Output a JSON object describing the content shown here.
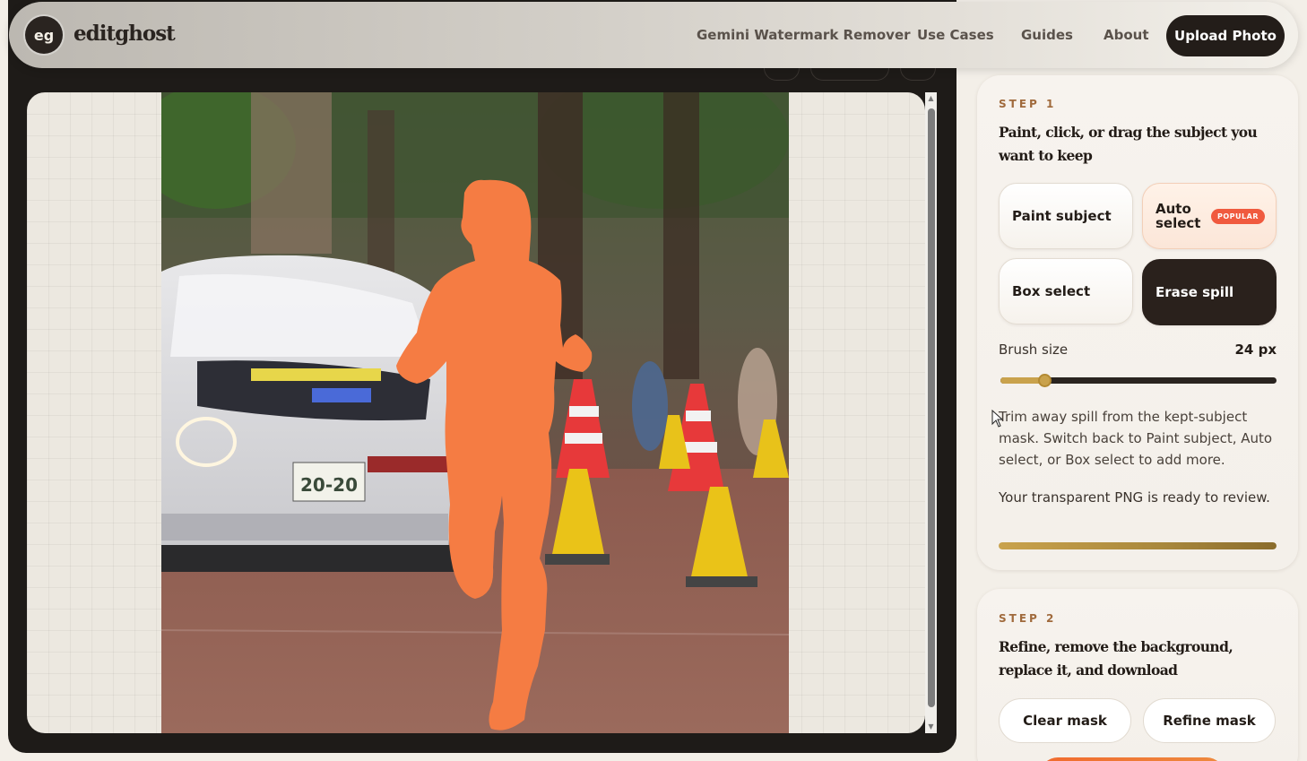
{
  "header": {
    "logo_badge": "eg",
    "logo_text": "editghost",
    "nav": [
      "Gemini Watermark Remover",
      "Use Cases",
      "Guides",
      "About"
    ],
    "upload_label": "Upload Photo"
  },
  "step1": {
    "label": "STEP 1",
    "title": "Paint, click, or drag the subject you want to keep",
    "tools": {
      "paint": "Paint subject",
      "auto": "Auto select",
      "auto_badge": "POPULAR",
      "box": "Box select",
      "erase": "Erase spill"
    },
    "active_tool": "Erase spill",
    "brush_label": "Brush size",
    "brush_value": "24 px",
    "brush_level": 0.16,
    "help_text": "Trim away spill from the kept-subject mask. Switch back to Paint subject, Auto select, or Box select to add more.",
    "ready_text": "Your transparent PNG is ready to review.",
    "progress": 1.0
  },
  "step2": {
    "label": "STEP 2",
    "title": "Refine, remove the background, replace it, and download",
    "clear_label": "Clear mask",
    "refine_label": "Refine mask"
  },
  "colors": {
    "accent_gold": "#c9a24c",
    "mask_orange": "#f57c43",
    "dark": "#231d19",
    "badge_red": "#f05a3f"
  }
}
